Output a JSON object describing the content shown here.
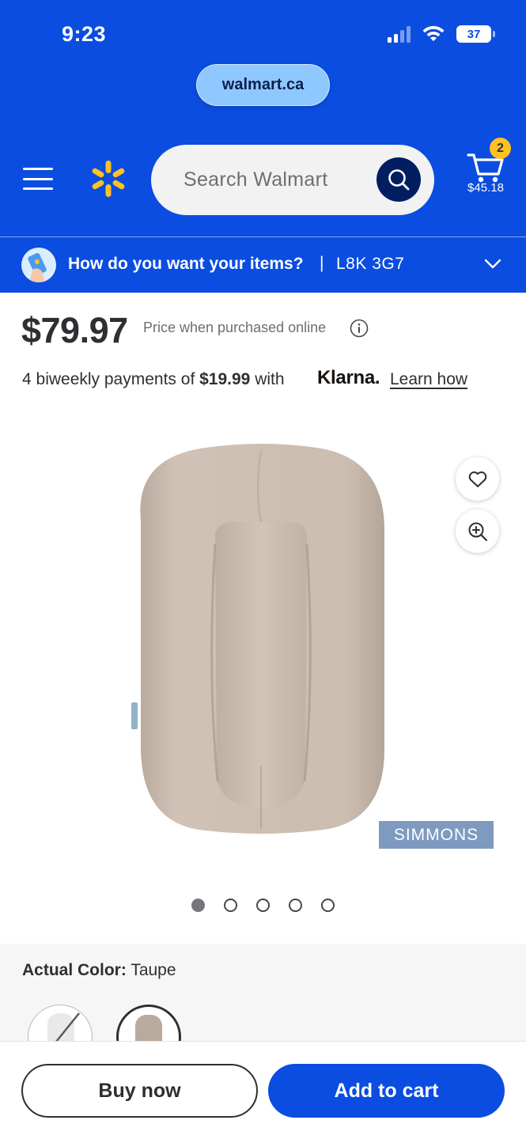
{
  "status_bar": {
    "time": "9:23",
    "battery": "37"
  },
  "browser": {
    "url": "walmart.ca"
  },
  "header": {
    "search_placeholder": "Search Walmart",
    "cart_count": "2",
    "cart_total": "$45.18"
  },
  "delivery": {
    "question": "How do you want your items?",
    "separator": "|",
    "postal_code": "L8K 3G7"
  },
  "product": {
    "price": "$79.97",
    "price_note": "Price when purchased online",
    "payment_prefix": "4 biweekly payments of",
    "payment_amount": "$19.99",
    "payment_with": "with",
    "klarna_logo": "Klarna.",
    "learn_how": "Learn how",
    "brand_tag": "SIMMONS",
    "image_count": 5,
    "active_image": 1
  },
  "color": {
    "label": "Actual Color:",
    "value": "Taupe"
  },
  "actions": {
    "buy_now": "Buy now",
    "add_to_cart": "Add to cart"
  },
  "colors": {
    "walmart_blue": "#0a4de0",
    "spark_yellow": "#ffc220",
    "dark_navy": "#001e60",
    "taupe": "#cfc0b2"
  }
}
